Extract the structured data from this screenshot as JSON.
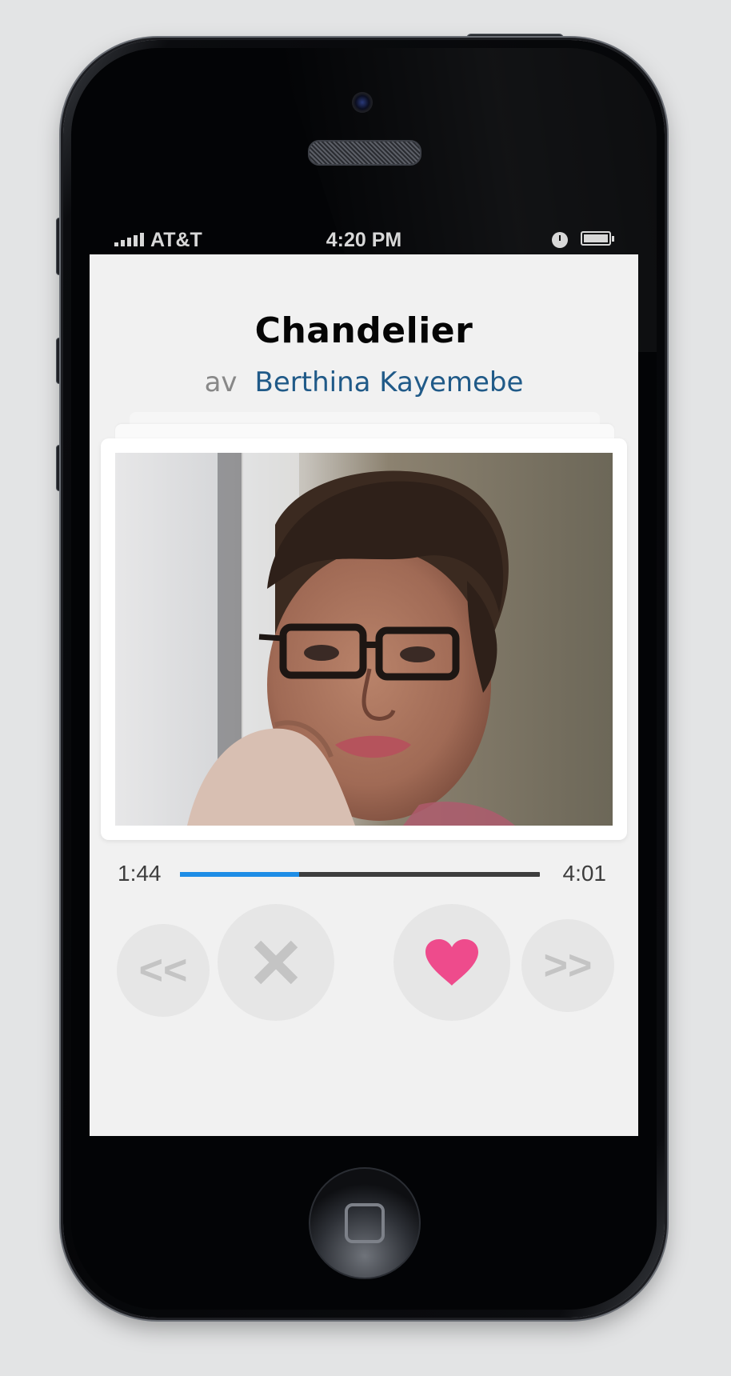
{
  "status_bar": {
    "carrier": "AT&T",
    "time": "4:20 PM",
    "signal_icon": "signal-bars-icon",
    "alarm_icon": "clock-icon",
    "battery_icon": "battery-icon"
  },
  "song": {
    "title": "Chandelier",
    "by_prefix": "av",
    "artist": "Berthina Kayemebe"
  },
  "player": {
    "current_time": "1:44",
    "total_time": "4:01",
    "progress_fraction": 0.33,
    "accent_color": "#1e8de6"
  },
  "controls": {
    "prev_label": "<<",
    "next_label": ">>",
    "dislike_icon": "close-x-icon",
    "like_icon": "heart-icon",
    "like_color": "#ee4b8c"
  }
}
